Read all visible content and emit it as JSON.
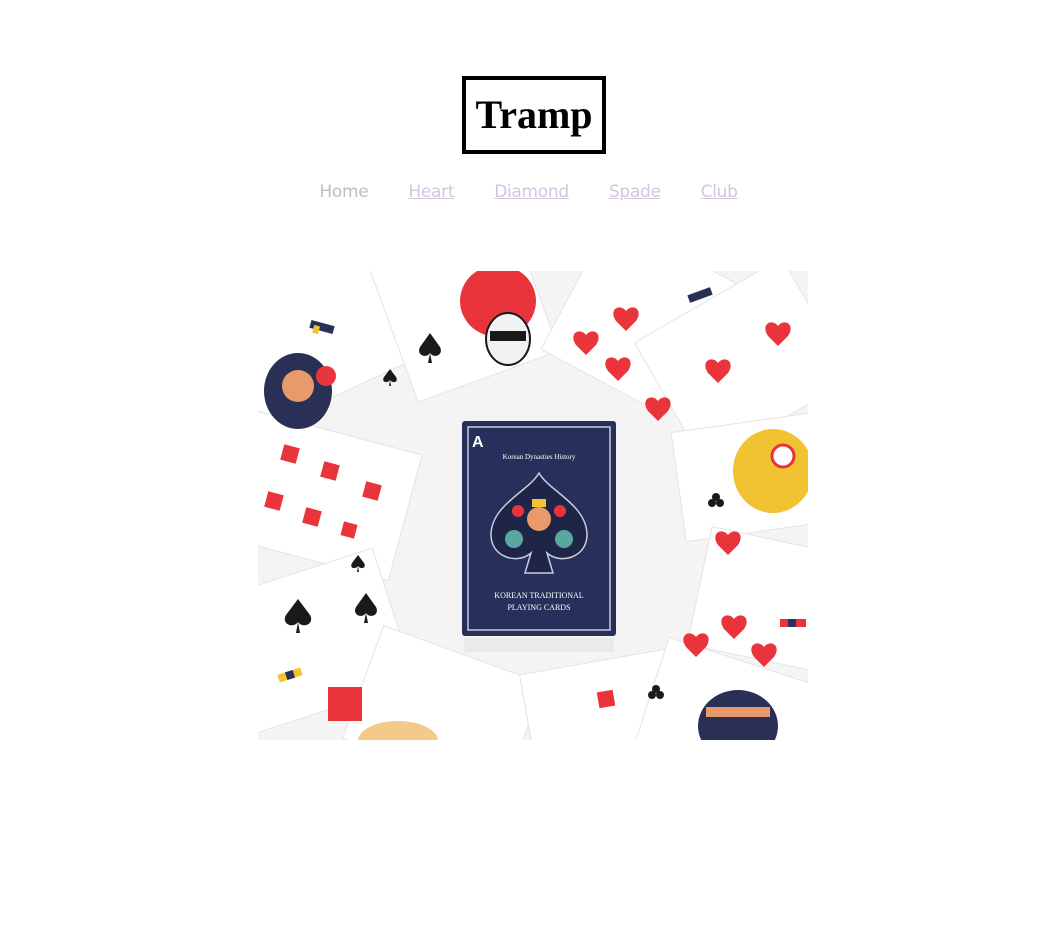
{
  "site": {
    "title": "Tramp"
  },
  "nav": {
    "items": [
      {
        "label": "Home",
        "active": true
      },
      {
        "label": "Heart",
        "active": false
      },
      {
        "label": "Diamond",
        "active": false
      },
      {
        "label": "Spade",
        "active": false
      },
      {
        "label": "Club",
        "active": false
      }
    ]
  },
  "hero": {
    "deck_header": "Korean Dynasties History",
    "deck_title_1": "KOREAN TRADITIONAL",
    "deck_title_2": "PLAYING CARDS",
    "deck_corner": "A",
    "colors": {
      "deck_navy": "#26305a",
      "card_red": "#e8343a",
      "card_black": "#1a1a1a",
      "background": "#ffffff"
    }
  }
}
